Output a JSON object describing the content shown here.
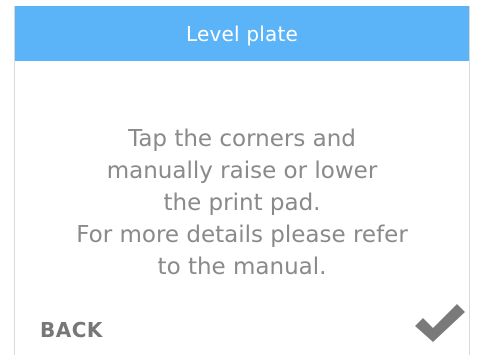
{
  "header": {
    "title": "Level plate"
  },
  "message": {
    "lines": [
      "Tap the corners and",
      "manually raise or lower",
      "the print pad.",
      "For more details please refer",
      "to the manual."
    ]
  },
  "footer": {
    "back_label": "BACK",
    "confirm_icon": "checkmark-icon"
  },
  "colors": {
    "header_bg": "#5bb4f7",
    "text": "#8a8a8a",
    "button_text": "#777777",
    "check": "#7a7a7a"
  }
}
